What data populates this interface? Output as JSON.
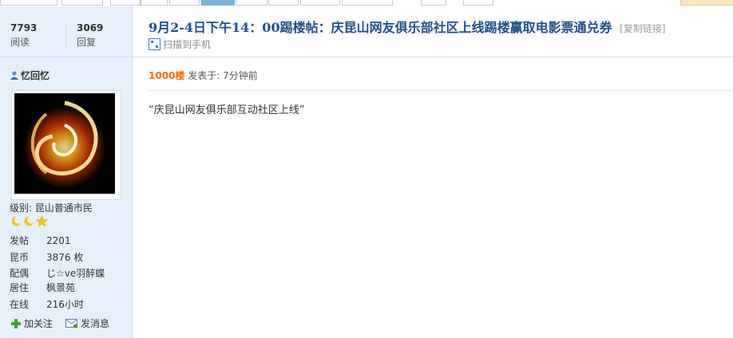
{
  "stats": {
    "views_num": "7793",
    "views_label": "阅读",
    "replies_num": "3069",
    "replies_label": "回复"
  },
  "thread": {
    "title": "9月2-4日下午14：00踢楼帖：庆昆山网友俱乐部社区上线踢楼赢取电影票通兑券",
    "copy_link": "[复制链接]",
    "scan_label": "扫描到手机"
  },
  "author": {
    "name": "忆回忆",
    "level_label": "级别:",
    "level_value": "昆山普通市民",
    "fields": [
      {
        "key": "发帖",
        "value": "2201"
      },
      {
        "key": "昆币",
        "value": "3876 枚"
      },
      {
        "key": "配偶",
        "value": "じ☆ve羽醉蝶"
      },
      {
        "key": "居住",
        "value": "枫景苑"
      },
      {
        "key": "在线",
        "value": "216小时"
      }
    ],
    "follow_label": "加关注",
    "message_label": "发消息"
  },
  "post": {
    "floor": "1000楼",
    "posted_label": "发表于: 7分钟前",
    "content": "“庆昆山网友俱乐部互动社区上线”"
  },
  "colors": {
    "title": "#1d4f8c",
    "floor": "#f26c00",
    "side_bg": "#e6f0fb"
  }
}
